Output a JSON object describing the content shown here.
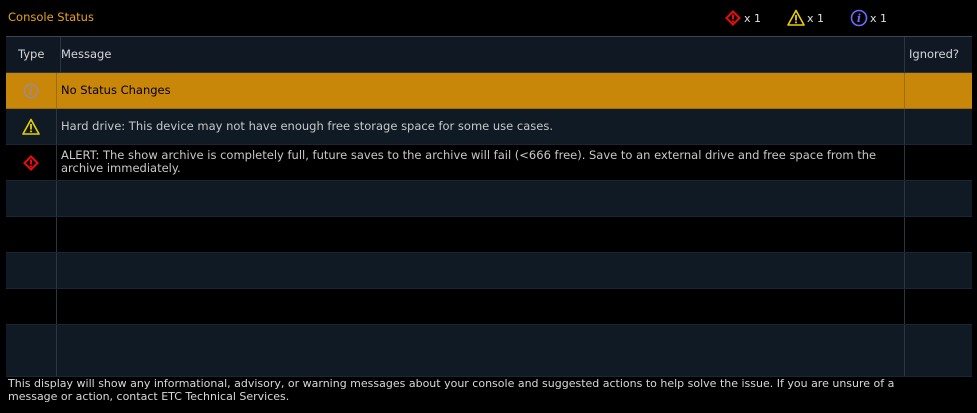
{
  "window": {
    "title": "Console Status"
  },
  "counts": {
    "alert": "x 1",
    "warning": "x 1",
    "info": "x 1"
  },
  "columns": {
    "type": "Type",
    "message": "Message",
    "ignored": "Ignored?"
  },
  "rows": [
    {
      "type": "info",
      "message": "No Status Changes",
      "selected": true
    },
    {
      "type": "warning",
      "message": "Hard drive: This device may not have enough free storage space for some use cases."
    },
    {
      "type": "alert",
      "message": "ALERT: The show archive is completely full, future saves to the archive will fail (<666 free). Save to an external drive and free space from the archive immediately."
    }
  ],
  "footer": {
    "text": "This display will show any informational, advisory, or warning messages about your console and suggested actions to help solve the issue. If you are unsure of a message or action, contact ETC Technical Services."
  },
  "colors": {
    "title": "#e8a317",
    "selected_row": "#c9870a",
    "alert_icon": "#e01010",
    "warning_icon": "#e8d000",
    "info_icon": "#6a6aff"
  }
}
